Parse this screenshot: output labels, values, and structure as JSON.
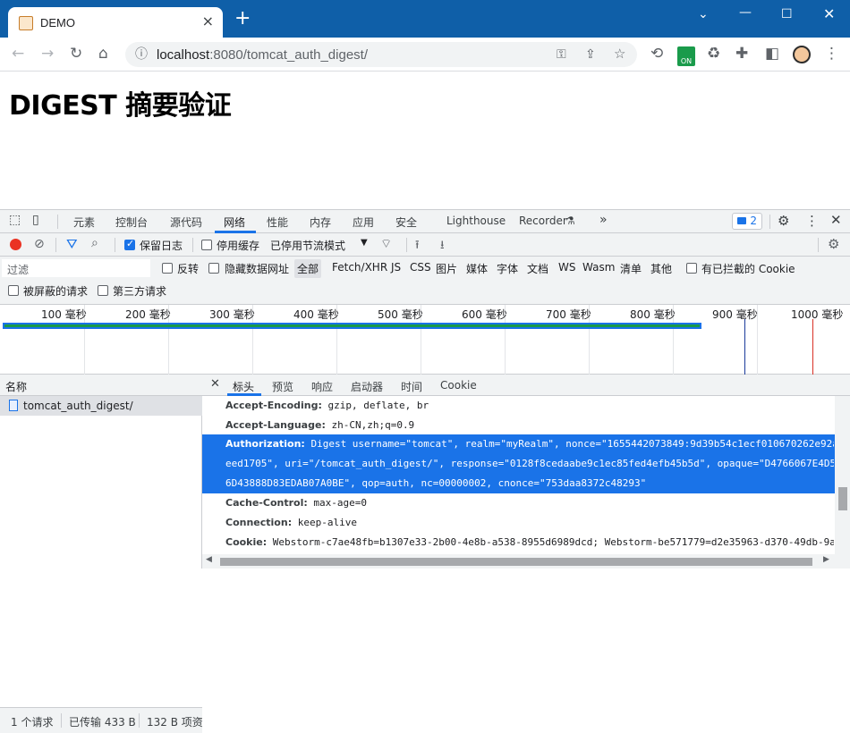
{
  "browser": {
    "tab_title": "DEMO",
    "url_host": "localhost",
    "url_path": ":8080/tomcat_auth_digest/",
    "ext_on_label": "ON"
  },
  "page": {
    "title": "DIGEST 摘要验证"
  },
  "devtools": {
    "tabs": [
      "元素",
      "控制台",
      "源代码",
      "网络",
      "性能",
      "内存",
      "应用",
      "安全",
      "Lighthouse",
      "Recorder"
    ],
    "active_tab": "网络",
    "issues_count": "2",
    "toolbar": {
      "preserve_log": "保留日志",
      "disable_cache": "停用缓存",
      "throttle": "已停用节流模式"
    },
    "filter": {
      "placeholder": "过滤",
      "invert": "反转",
      "hide_data_urls": "隐藏数据网址",
      "types": [
        "全部",
        "Fetch/XHR",
        "JS",
        "CSS",
        "图片",
        "媒体",
        "字体",
        "文档",
        "WS",
        "Wasm",
        "清单",
        "其他"
      ],
      "blocked_cookies": "有已拦截的 Cookie",
      "blocked_requests": "被屏蔽的请求",
      "third_party": "第三方请求"
    },
    "timeline_ticks": [
      "100 毫秒",
      "200 毫秒",
      "300 毫秒",
      "400 毫秒",
      "500 毫秒",
      "600 毫秒",
      "700 毫秒",
      "800 毫秒",
      "900 毫秒",
      "1000 毫秒"
    ],
    "list": {
      "header": "名称",
      "rows": [
        "tomcat_auth_digest/"
      ]
    },
    "status": {
      "requests": "1 个请求",
      "transferred": "已传输 433 B",
      "resources": "132 B 项资"
    },
    "details": {
      "tabs": [
        "标头",
        "预览",
        "响应",
        "启动器",
        "时间",
        "Cookie"
      ],
      "active_tab": "标头",
      "headers": {
        "accept_encoding_name": "Accept-Encoding:",
        "accept_encoding_value": "gzip, deflate, br",
        "accept_language_name": "Accept-Language:",
        "accept_language_value": "zh-CN,zh;q=0.9",
        "authorization_name": "Authorization:",
        "authorization_line1": "Digest username=\"tomcat\", realm=\"myRealm\", nonce=\"1655442073849:9d39b54c1ecf010670262e92a",
        "authorization_line2": "eed1705\", uri=\"/tomcat_auth_digest/\", response=\"0128f8cedaabe9c1ec85fed4efb45b5d\", opaque=\"D4766067E4D5",
        "authorization_line3": "6D43888D83EDAB07A0BE\", qop=auth, nc=00000002, cnonce=\"753daa8372c48293\"",
        "cache_control_name": "Cache-Control:",
        "cache_control_value": "max-age=0",
        "connection_name": "Connection:",
        "connection_value": "keep-alive",
        "cookie_name": "Cookie:",
        "cookie_value": "Webstorm-c7ae48fb=b1307e33-2b00-4e8b-a538-8955d6989dcd; Webstorm-be571779=d2e35963-d370-49db-9a"
      }
    }
  }
}
